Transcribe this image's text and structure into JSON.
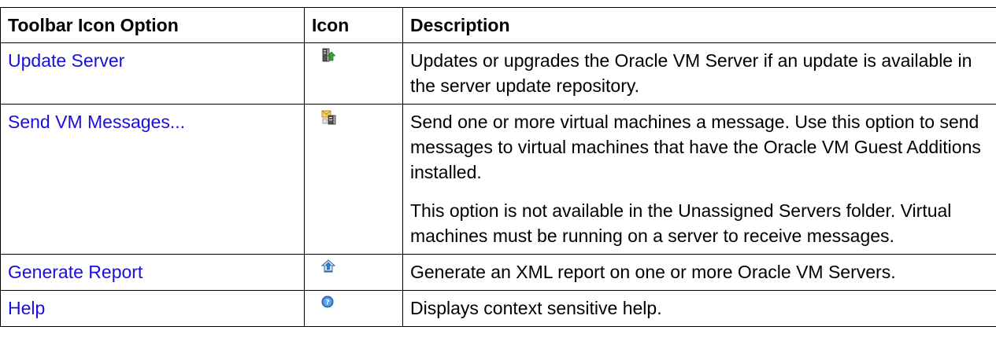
{
  "headers": {
    "option": "Toolbar Icon Option",
    "icon": "Icon",
    "description": "Description"
  },
  "rows": [
    {
      "option": "Update Server",
      "icon": "update-server-icon",
      "description": [
        "Updates or upgrades the Oracle VM Server if an update is available in the server update repository."
      ]
    },
    {
      "option": "Send VM Messages...",
      "icon": "send-vm-messages-icon",
      "description": [
        "Send one or more virtual machines a message. Use this option to send messages to virtual machines that have the Oracle VM Guest Additions installed.",
        "This option is not available in the Unassigned Servers folder. Virtual machines must be running on a server to receive messages."
      ]
    },
    {
      "option": "Generate Report",
      "icon": "generate-report-icon",
      "description": [
        "Generate an XML report on one or more Oracle VM Servers."
      ]
    },
    {
      "option": "Help",
      "icon": "help-icon",
      "description": [
        "Displays context sensitive help."
      ]
    }
  ],
  "colors": {
    "link": "#1a0dde",
    "border": "#000000"
  }
}
